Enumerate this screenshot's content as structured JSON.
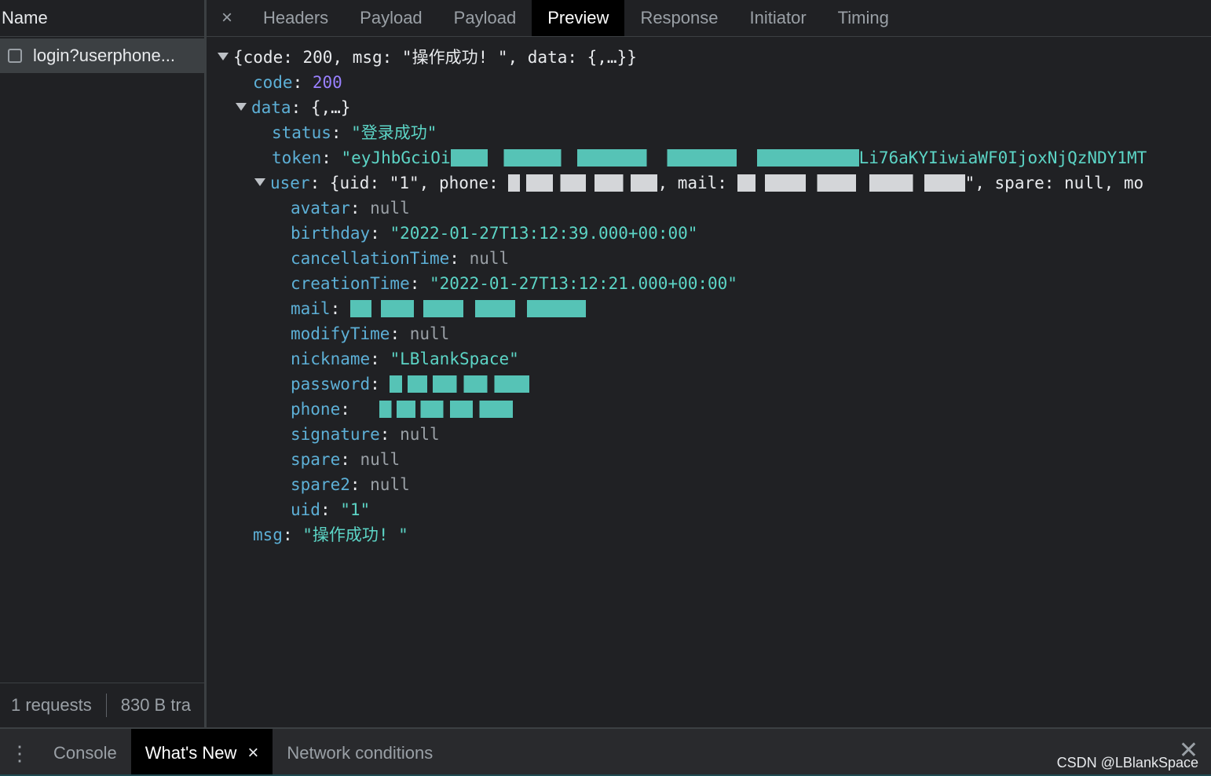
{
  "request_list": {
    "header": "Name",
    "items": [
      {
        "name": "login?userphone..."
      }
    ],
    "footer": {
      "requests": "1 requests",
      "transferred": "830 B tra"
    }
  },
  "detail_tabs": {
    "close_symbol": "×",
    "tabs": [
      "Headers",
      "Payload",
      "Payload",
      "Preview",
      "Response",
      "Initiator",
      "Timing"
    ],
    "active": "Preview"
  },
  "preview": {
    "root_summary": "{code: 200, msg: \"操作成功! \", data: {,…}}",
    "code_key": "code",
    "code_value": "200",
    "data_key": "data",
    "data_summary": "{,…}",
    "status_key": "status",
    "status_value": "\"登录成功\"",
    "token_key": "token",
    "token_value_start": "\"eyJhbGciOi",
    "token_value_end": "Li76aKYIiwiaWF0IjoxNjQzNDY1MT",
    "user_key": "user",
    "user_summary_1": "{uid: \"1\", phone: ",
    "user_summary_2": ", mail: ",
    "user_summary_3": "\", spare: null, mo",
    "fields": [
      {
        "key": "avatar",
        "value": "null",
        "type": "null"
      },
      {
        "key": "birthday",
        "value": "\"2022-01-27T13:12:39.000+00:00\"",
        "type": "str"
      },
      {
        "key": "cancellationTime",
        "value": "null",
        "type": "null"
      },
      {
        "key": "creationTime",
        "value": "\"2022-01-27T13:12:21.000+00:00\"",
        "type": "str"
      },
      {
        "key": "mail",
        "value": "",
        "type": "redacted"
      },
      {
        "key": "modifyTime",
        "value": "null",
        "type": "null"
      },
      {
        "key": "nickname",
        "value": "\"LBlankSpace\"",
        "type": "str"
      },
      {
        "key": "password",
        "value": "",
        "type": "redacted"
      },
      {
        "key": "phone",
        "value": "",
        "type": "redacted"
      },
      {
        "key": "signature",
        "value": "null",
        "type": "null"
      },
      {
        "key": "spare",
        "value": "null",
        "type": "null"
      },
      {
        "key": "spare2",
        "value": "null",
        "type": "null"
      },
      {
        "key": "uid",
        "value": "\"1\"",
        "type": "str"
      }
    ],
    "msg_key": "msg",
    "msg_value": "\"操作成功! \""
  },
  "drawer": {
    "menu_symbol": "⋮",
    "tabs": [
      "Console",
      "What's New",
      "Network conditions"
    ],
    "active": "What's New",
    "tab_close_symbol": "×",
    "close_symbol": "✕",
    "watermark": "CSDN @LBlankSpace"
  },
  "colors": {
    "background": "#202124",
    "key": "#5db0d7",
    "string": "#5cd5c6",
    "number": "#9980ff",
    "null": "#9aa0a6"
  }
}
